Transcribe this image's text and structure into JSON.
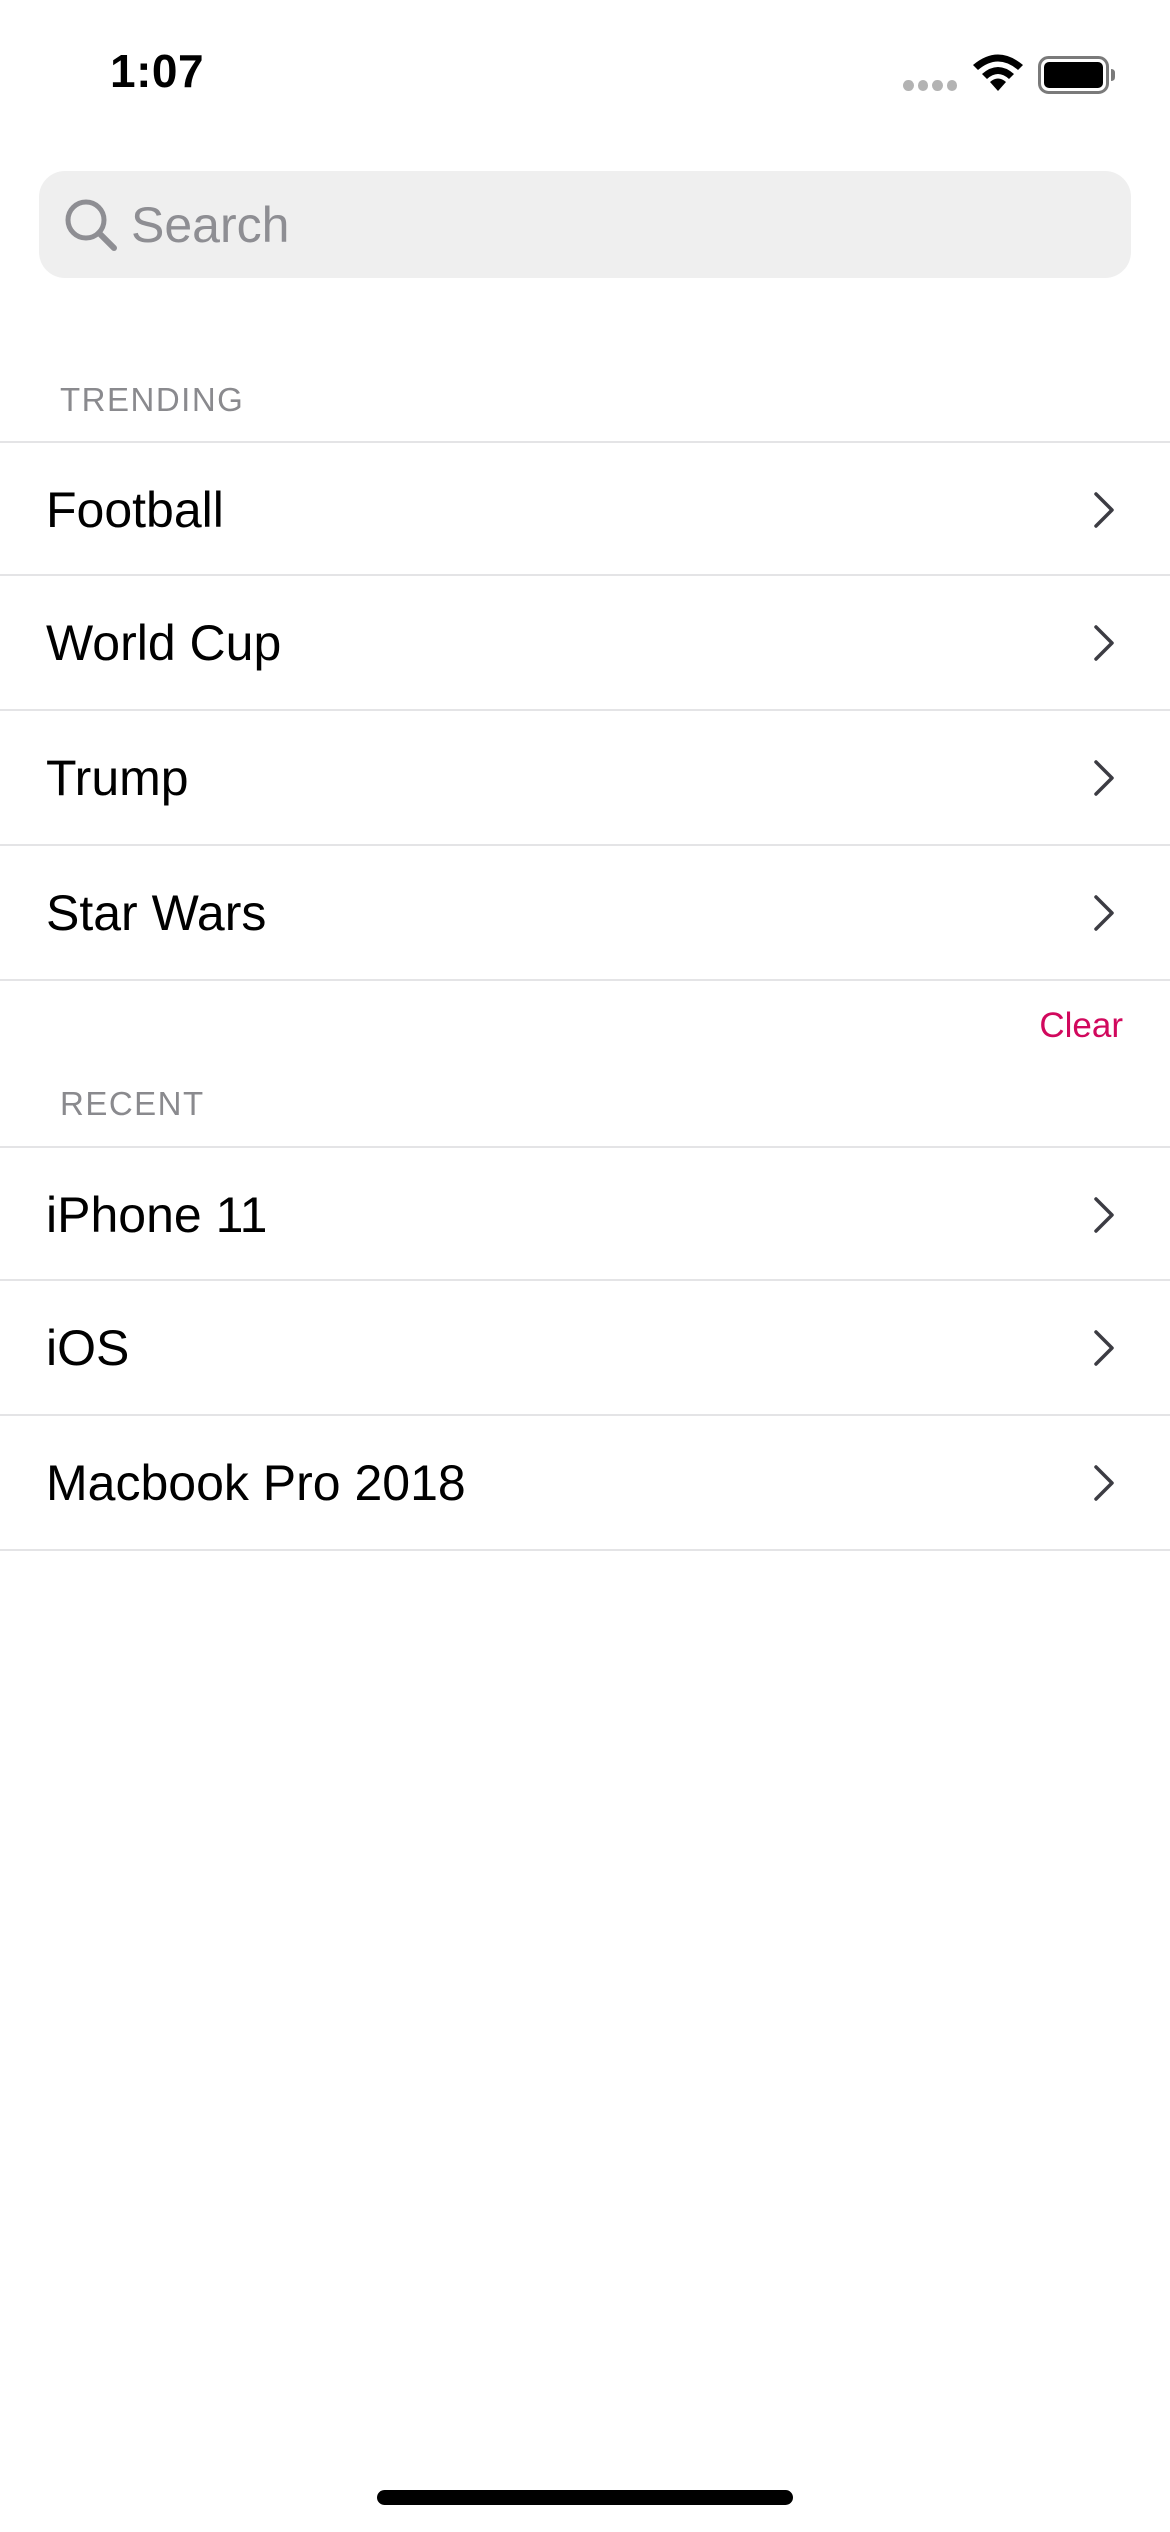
{
  "status_bar": {
    "time": "1:07",
    "icons": [
      "cellular-signal-icon",
      "wifi-icon",
      "battery-icon"
    ]
  },
  "search": {
    "placeholder": "Search",
    "value": ""
  },
  "trending": {
    "header": "TRENDING",
    "items": [
      "Football",
      "World Cup",
      "Trump",
      "Star Wars"
    ]
  },
  "recent": {
    "clear_label": "Clear",
    "header": "RECENT",
    "items": [
      "iPhone 11",
      "iOS",
      "Macbook Pro 2018"
    ]
  },
  "colors": {
    "accent": "#d1085d",
    "search_background": "#efefef",
    "secondary_text": "#8a8a8e",
    "separator": "#e4e4e6"
  }
}
